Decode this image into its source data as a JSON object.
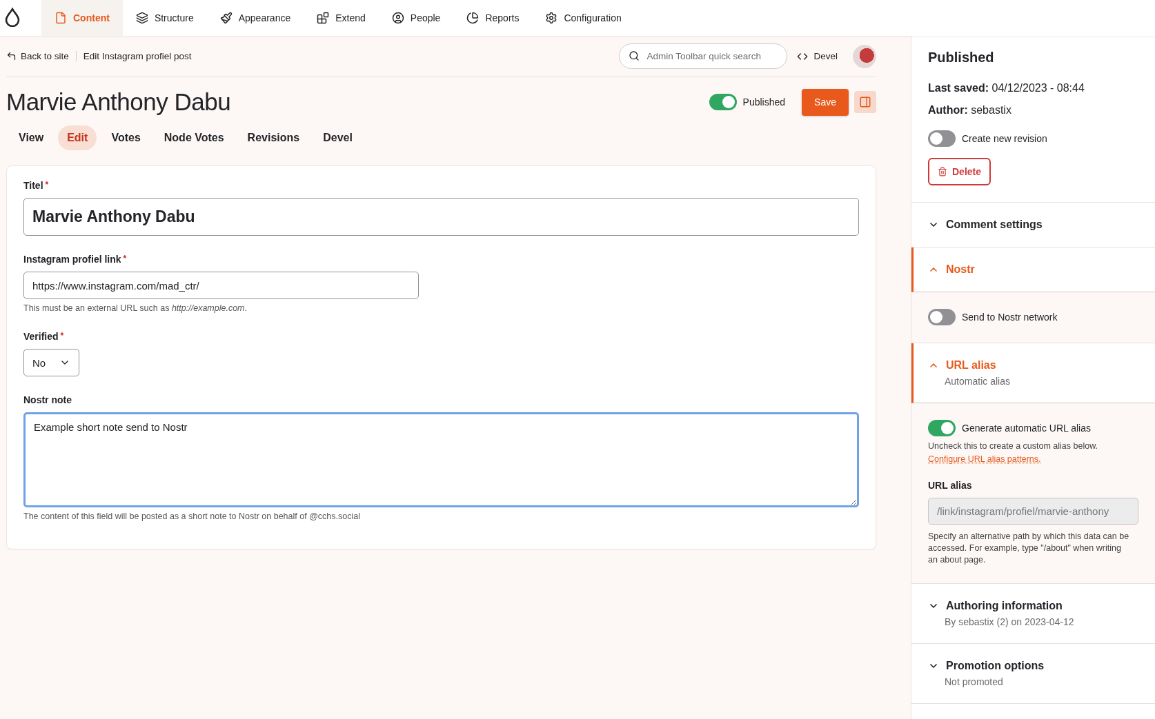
{
  "toolbar": {
    "nav": [
      {
        "label": "Content",
        "selected": true
      },
      {
        "label": "Structure",
        "selected": false
      },
      {
        "label": "Appearance",
        "selected": false
      },
      {
        "label": "Extend",
        "selected": false
      },
      {
        "label": "People",
        "selected": false
      },
      {
        "label": "Reports",
        "selected": false
      },
      {
        "label": "Configuration",
        "selected": false
      }
    ]
  },
  "header": {
    "back_link": "Back to site",
    "breadcrumb": "Edit Instagram profiel post",
    "search": {
      "placeholder": "Admin Toolbar quick search"
    },
    "devel_link": "Devel"
  },
  "page": {
    "title": "Marvie Anthony Dabu",
    "published": {
      "label": "Published",
      "on": true
    },
    "save_button": "Save"
  },
  "tabs": [
    {
      "label": "View",
      "selected": false
    },
    {
      "label": "Edit",
      "selected": true
    },
    {
      "label": "Votes",
      "selected": false
    },
    {
      "label": "Node Votes",
      "selected": false
    },
    {
      "label": "Revisions",
      "selected": false
    },
    {
      "label": "Devel",
      "selected": false
    }
  ],
  "form": {
    "fields": [
      {
        "kind": "title",
        "label": "Titel",
        "required_mark": "*",
        "value": "Marvie Anthony Dabu"
      },
      {
        "kind": "url",
        "label": "Instagram profiel link",
        "required_mark": "*",
        "value": "https://www.instagram.com/mad_ctr/",
        "description": "This must be an external URL such as *http://example.com*."
      },
      {
        "kind": "select",
        "label": "Verified",
        "required_mark": "*",
        "value": "No"
      },
      {
        "kind": "textarea",
        "label": "Nostr note",
        "value": "Example short note send to Nostr",
        "focused": true,
        "description": "The content of this field will be posted as a short note to Nostr on behalf of @cchs.social"
      }
    ]
  },
  "sidebar": {
    "heading": "Published",
    "last_saved": "**Last saved:** 04/12/2023 - 08:44",
    "author": "**Author:** sebastix",
    "create_revision": {
      "label": "Create new revision",
      "on": false
    },
    "delete_button": "Delete",
    "sections": [
      {
        "title": "Comment settings",
        "expanded": false
      },
      {
        "kind": "nostr",
        "title": "Nostr",
        "expanded": true,
        "toggle": {
          "label": "Send to Nostr network",
          "on": false
        }
      },
      {
        "kind": "alias",
        "title": "URL alias",
        "summary": "Automatic alias",
        "expanded": true,
        "toggle": {
          "label": "Generate automatic URL alias",
          "on": true
        },
        "toggle_help": "Uncheck this to create a custom alias below.",
        "link": "Configure URL alias patterns.",
        "field_label": "URL alias",
        "field_value": "/link/instagram/profiel/marvie-anthony",
        "field_help": "Specify an alternative path by which this data can be accessed. For example, type \"/about\" when writing an about page."
      },
      {
        "title": "Authoring information",
        "summary": "By sebastix (2) on 2023-04-12",
        "expanded": false
      },
      {
        "title": "Promotion options",
        "summary": "Not promoted",
        "expanded": false
      }
    ]
  }
}
